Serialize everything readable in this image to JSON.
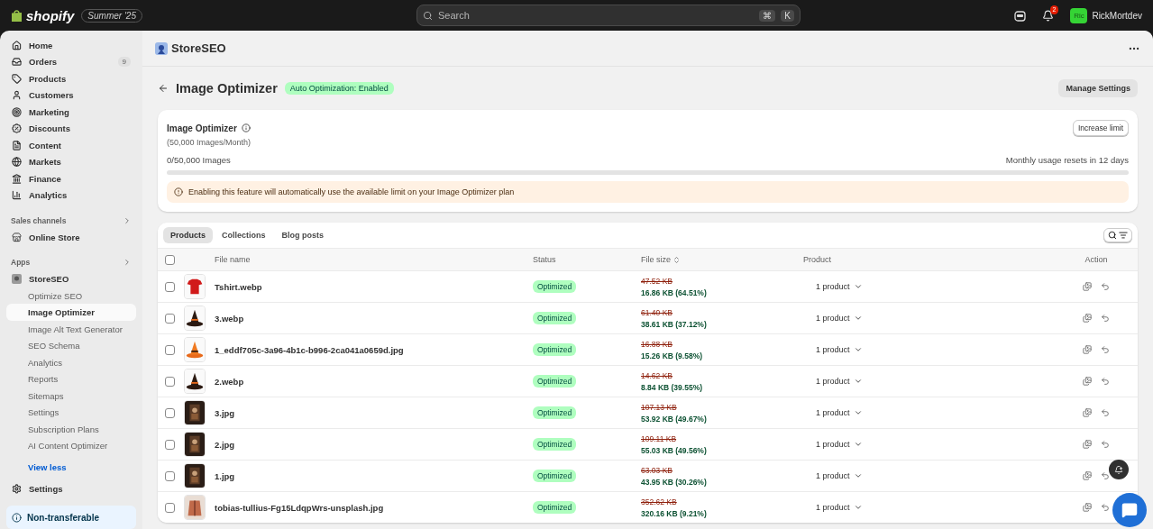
{
  "topbar": {
    "logo": "shopify",
    "edition": "Summer '25",
    "search": {
      "placeholder": "Search",
      "shortcut": [
        "⌘",
        "K"
      ]
    },
    "notifications": "2",
    "avatar": "Ric",
    "user": "RickMortdev"
  },
  "sidebar": {
    "items": [
      {
        "label": "Home",
        "selected": false
      },
      {
        "label": "Orders",
        "badge": "9",
        "selected": false
      },
      {
        "label": "Products",
        "selected": false
      },
      {
        "label": "Customers",
        "selected": false
      },
      {
        "label": "Marketing",
        "selected": false
      },
      {
        "label": "Discounts",
        "selected": false
      },
      {
        "label": "Content",
        "selected": false
      },
      {
        "label": "Markets",
        "selected": false
      },
      {
        "label": "Finance",
        "selected": false
      },
      {
        "label": "Analytics",
        "selected": false
      }
    ],
    "sales_channels": {
      "title": "Sales channels",
      "items": [
        {
          "label": "Online Store"
        }
      ]
    },
    "apps": {
      "title": "Apps",
      "app": "StoreSEO",
      "children": [
        {
          "label": "Optimize SEO",
          "selected": false
        },
        {
          "label": "Image Optimizer",
          "selected": true
        },
        {
          "label": "Image Alt Text Generator",
          "selected": false
        },
        {
          "label": "SEO Schema",
          "selected": false
        },
        {
          "label": "Analytics",
          "selected": false
        },
        {
          "label": "Reports",
          "selected": false
        },
        {
          "label": "Sitemaps",
          "selected": false
        },
        {
          "label": "Settings",
          "selected": false
        },
        {
          "label": "Subscription Plans",
          "selected": false
        },
        {
          "label": "AI Content Optimizer",
          "selected": false
        }
      ],
      "view_less": "View less"
    },
    "settings": "Settings",
    "notice": "Non-transferable"
  },
  "app_header": {
    "title": "StoreSEO"
  },
  "page": {
    "title": "Image Optimizer",
    "badge": "Auto Optimization: Enabled",
    "action": "Manage Settings"
  },
  "usage_card": {
    "title": "Image Optimizer",
    "subtitle": "(50,000 Images/Month)",
    "button": "Increase limit",
    "usage": "0/50,000 Images",
    "reset": "Monthly usage resets in 12 days",
    "banner": "Enabling this feature will automatically use the available limit on your Image Optimizer plan"
  },
  "tabs": [
    {
      "label": "Products",
      "selected": true
    },
    {
      "label": "Collections",
      "selected": false
    },
    {
      "label": "Blog posts",
      "selected": false
    }
  ],
  "table": {
    "select_all": {
      "checked": false
    },
    "columns": [
      "File name",
      "Status",
      "File size",
      "Product",
      "Action"
    ],
    "rows": [
      {
        "checked": false,
        "file": "Tshirt.webp",
        "status": "Optimized",
        "old_size": "47.52 KB",
        "new_size": "16.86 KB (64.51%)",
        "product": "1 product"
      },
      {
        "checked": false,
        "file": "3.webp",
        "status": "Optimized",
        "old_size": "61.40 KB",
        "new_size": "38.61 KB (37.12%)",
        "product": "1 product"
      },
      {
        "checked": false,
        "file": "1_eddf705c-3a96-4b1c-b996-2ca041a0659d.jpg",
        "status": "Optimized",
        "old_size": "16.88 KB",
        "new_size": "15.26 KB (9.58%)",
        "product": "1 product"
      },
      {
        "checked": false,
        "file": "2.webp",
        "status": "Optimized",
        "old_size": "14.62 KB",
        "new_size": "8.84 KB (39.55%)",
        "product": "1 product"
      },
      {
        "checked": false,
        "file": "3.jpg",
        "status": "Optimized",
        "old_size": "107.13 KB",
        "new_size": "53.92 KB (49.67%)",
        "product": "1 product"
      },
      {
        "checked": false,
        "file": "2.jpg",
        "status": "Optimized",
        "old_size": "109.11 KB",
        "new_size": "55.03 KB (49.56%)",
        "product": "1 product"
      },
      {
        "checked": false,
        "file": "1.jpg",
        "status": "Optimized",
        "old_size": "63.03 KB",
        "new_size": "43.95 KB (30.26%)",
        "product": "1 product"
      },
      {
        "checked": false,
        "file": "tobias-tullius-Fg15LdqpWrs-unsplash.jpg",
        "status": "Optimized",
        "old_size": "352.62 KB",
        "new_size": "320.16 KB (9.21%)",
        "product": "1 product"
      }
    ]
  }
}
